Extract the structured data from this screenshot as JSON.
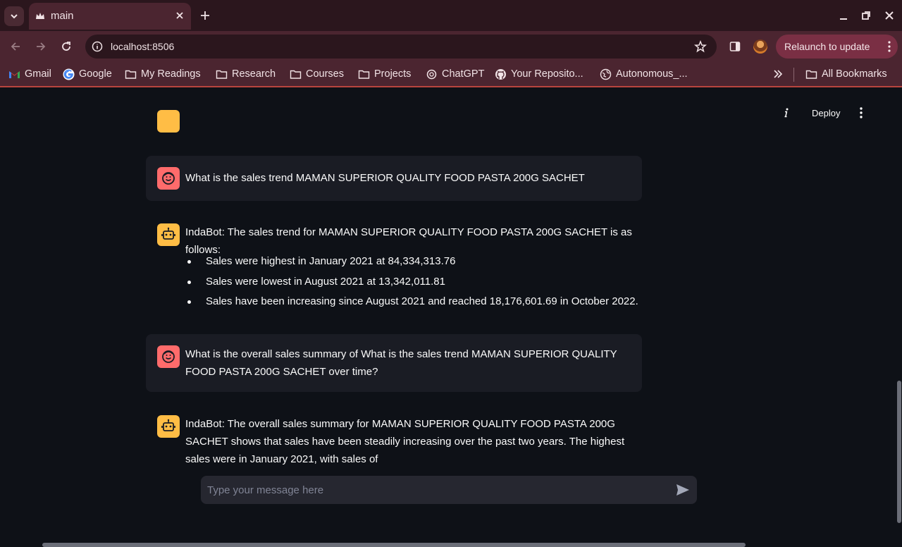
{
  "browser": {
    "tab": {
      "title": "main"
    },
    "url": "localhost:8506",
    "relaunch_label": "Relaunch to update",
    "bookmarks": [
      {
        "label": "Gmail",
        "icon": "gmail-icon"
      },
      {
        "label": "Google",
        "icon": "google-icon"
      },
      {
        "label": "My Readings",
        "icon": "folder-icon"
      },
      {
        "label": "Research",
        "icon": "folder-icon"
      },
      {
        "label": "Courses",
        "icon": "folder-icon"
      },
      {
        "label": "Projects",
        "icon": "folder-icon"
      },
      {
        "label": "ChatGPT",
        "icon": "chatgpt-icon"
      },
      {
        "label": "Your Reposito...",
        "icon": "github-icon"
      },
      {
        "label": "Autonomous_...",
        "icon": "globe-icon"
      }
    ],
    "all_bookmarks": "All Bookmarks"
  },
  "app": {
    "deploy_label": "Deploy",
    "messages": [
      {
        "role": "user",
        "text": "What is the sales trend MAMAN SUPERIOR QUALITY FOOD PASTA 200G SACHET"
      },
      {
        "role": "assistant",
        "text": "IndaBot: The sales trend for MAMAN SUPERIOR QUALITY FOOD PASTA 200G SACHET is as follows:",
        "bullets": [
          "Sales were highest in January 2021 at 84,334,313.76",
          "Sales were lowest in August 2021 at 13,342,011.81",
          "Sales have been increasing since August 2021 and reached 18,176,601.69 in October 2022."
        ]
      },
      {
        "role": "user",
        "text": "What is the overall sales summary of What is the sales trend MAMAN SUPERIOR QUALITY FOOD PASTA 200G SACHET over time?"
      },
      {
        "role": "assistant",
        "text": "IndaBot: The overall sales summary for MAMAN SUPERIOR QUALITY FOOD PASTA 200G SACHET shows that sales have been steadily increasing over the past two years. The highest sales were in January 2021, with sales of"
      }
    ],
    "input": {
      "placeholder": "Type your message here",
      "value": ""
    }
  },
  "colors": {
    "tab_strip": "#2b161d",
    "toolbar": "#4b2530",
    "relaunch": "#7a2f44",
    "app_bg": "#0e1117",
    "user_card": "#1a1c24",
    "user_avatar": "#ff6b6b",
    "bot_avatar": "#ffbd45"
  }
}
